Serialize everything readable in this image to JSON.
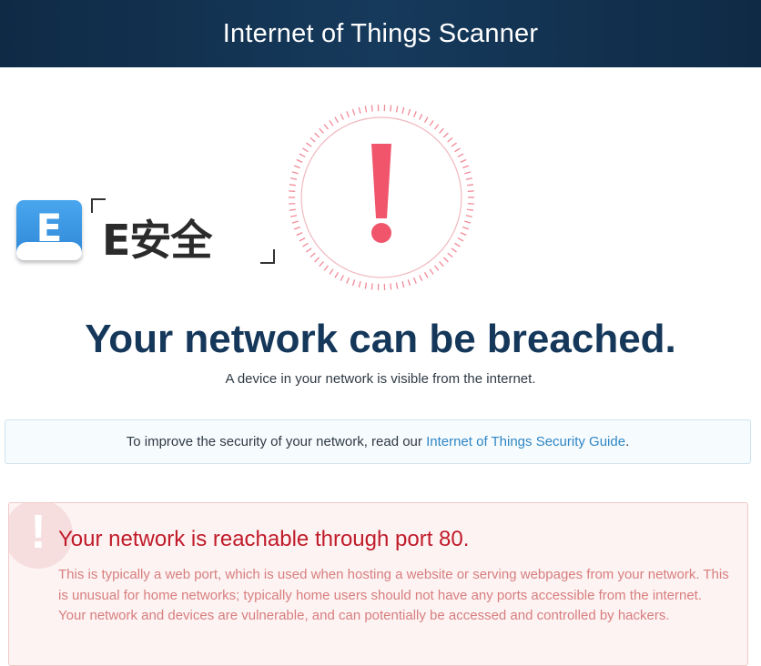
{
  "header": {
    "title": "Internet of Things Scanner"
  },
  "alert_graphic": {
    "icon": "exclamation-alert-icon",
    "color": "#f0556b"
  },
  "watermark": {
    "badge_letter": "E",
    "text": "E安全"
  },
  "result": {
    "headline": "Your network can be breached.",
    "subline": "A device in your network is visible from the internet."
  },
  "info": {
    "prefix": "To improve the security of your network, read our ",
    "link_text": "Internet of Things Security Guide",
    "suffix": "."
  },
  "warning": {
    "icon": "exclamation-icon",
    "title": "Your network is reachable through port 80.",
    "body": "This is typically a web port, which is used when hosting a website or serving webpages from your network. This is unusual for home networks; typically home users should not have any ports accessible from the internet. Your network and devices are vulnerable, and can potentially be accessed and controlled by hackers."
  },
  "colors": {
    "header_bg": "#14375a",
    "headline": "#14375a",
    "link": "#2f86c4",
    "warning_title": "#c01b2a",
    "warning_text": "#d87e7e"
  }
}
